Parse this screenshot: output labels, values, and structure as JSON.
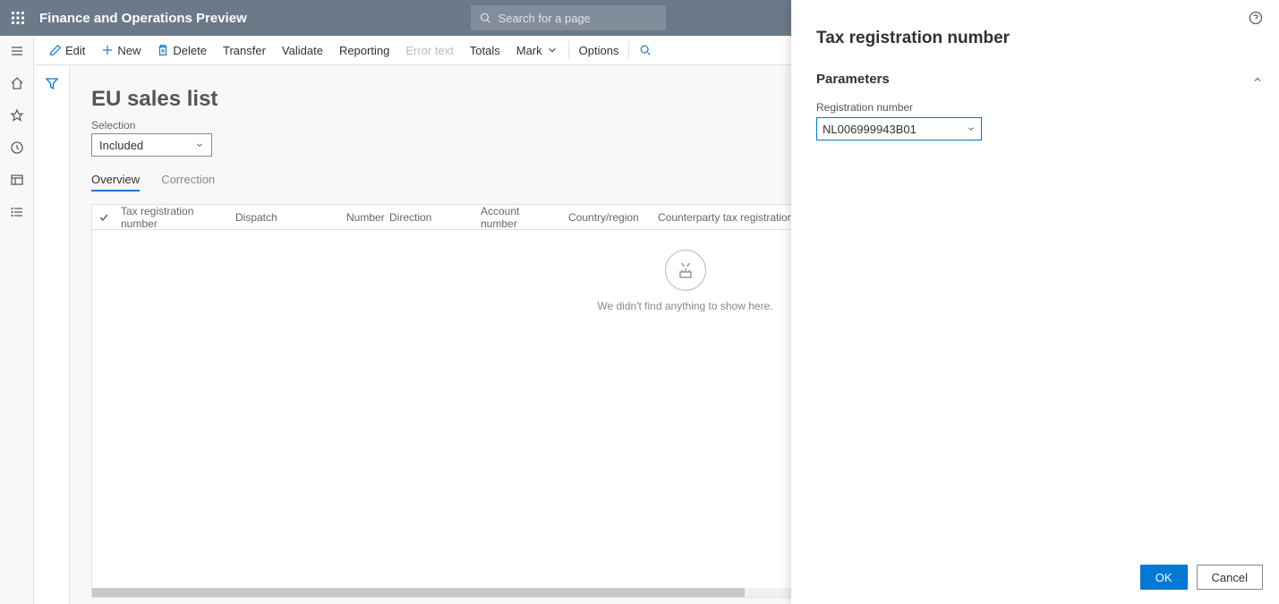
{
  "header": {
    "app_title": "Finance and Operations Preview",
    "search_placeholder": "Search for a page"
  },
  "toolbar": {
    "edit": "Edit",
    "new": "New",
    "delete": "Delete",
    "transfer": "Transfer",
    "validate": "Validate",
    "reporting": "Reporting",
    "error_text": "Error text",
    "totals": "Totals",
    "mark": "Mark",
    "options": "Options"
  },
  "page": {
    "title": "EU sales list",
    "selection_label": "Selection",
    "selection_value": "Included",
    "tabs": {
      "overview": "Overview",
      "correction": "Correction"
    },
    "columns": {
      "tax_reg": "Tax registration number",
      "dispatch": "Dispatch",
      "number": "Number",
      "direction": "Direction",
      "account": "Account number",
      "country": "Country/region",
      "counterparty": "Counterparty tax registration"
    },
    "empty_text": "We didn't find anything to show here."
  },
  "panel": {
    "title": "Tax registration number",
    "section": "Parameters",
    "field_label": "Registration number",
    "field_value": "NL006999943B01",
    "ok": "OK",
    "cancel": "Cancel"
  }
}
